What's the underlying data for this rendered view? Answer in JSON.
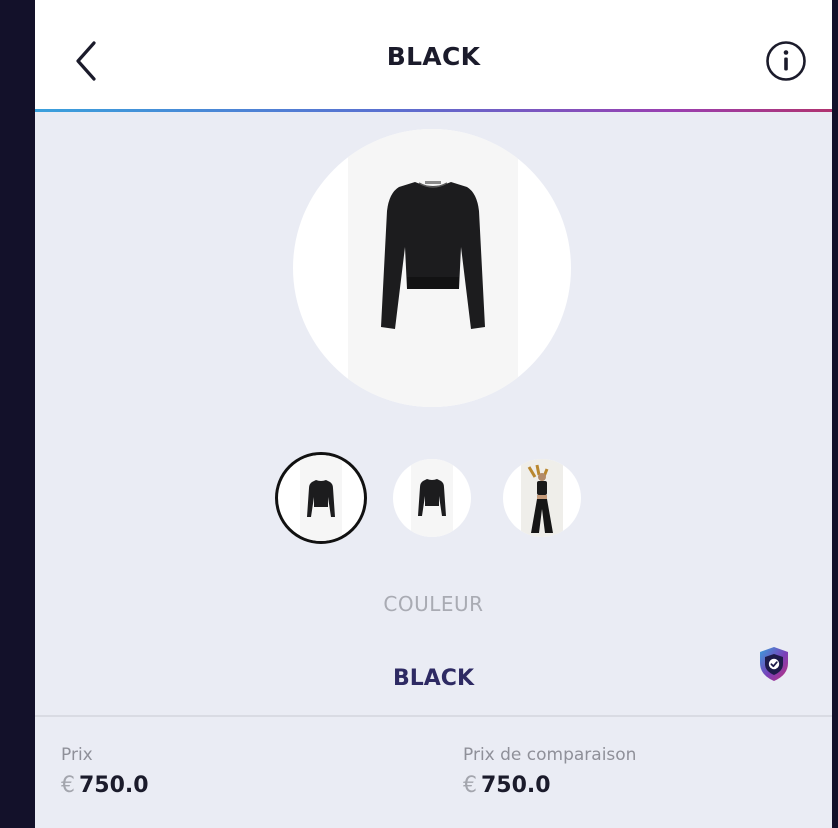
{
  "header": {
    "title": "BLACK"
  },
  "thumbnails": [
    {
      "name": "thumb-1",
      "selected": true
    },
    {
      "name": "thumb-2",
      "selected": false
    },
    {
      "name": "thumb-3",
      "selected": false
    }
  ],
  "color_section": {
    "label": "COULEUR",
    "value": "BLACK"
  },
  "prices": {
    "price": {
      "label": "Prix",
      "currency": "€",
      "amount": "750.0"
    },
    "compare_price": {
      "label": "Prix de comparaison",
      "currency": "€",
      "amount": "750.0"
    }
  },
  "colors": {
    "accent_text": "#2e2a63",
    "gradient": [
      "#3aa0dc",
      "#5b6fd0",
      "#9a3fb0",
      "#b0336f"
    ]
  },
  "icons": {
    "back": "chevron-left-icon",
    "info": "info-icon",
    "shield": "shield-check-icon"
  }
}
